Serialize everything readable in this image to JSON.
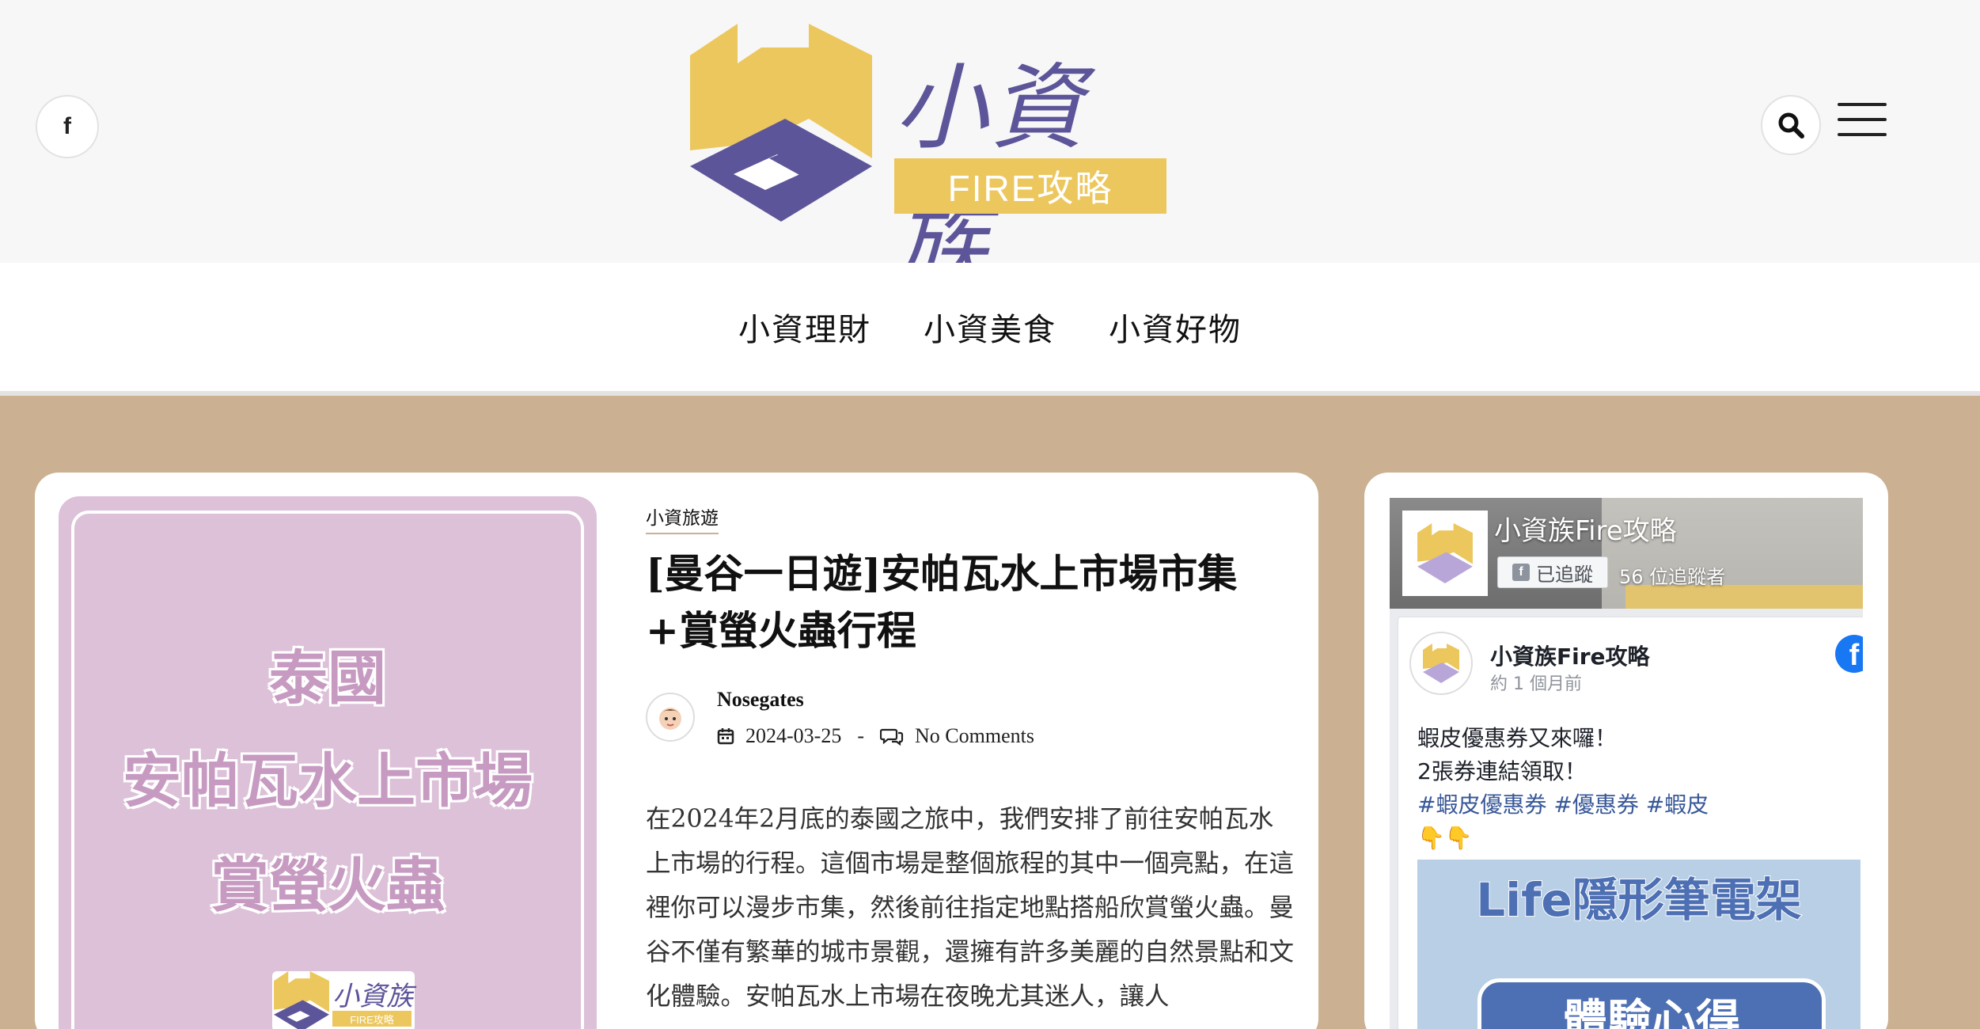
{
  "header": {
    "facebook_icon_label": "f",
    "logo": {
      "name": "小資族",
      "tagline": "FIRE攻略"
    }
  },
  "nav": {
    "items": [
      {
        "label": "小資理財"
      },
      {
        "label": "小資美食"
      },
      {
        "label": "小資好物"
      }
    ]
  },
  "post": {
    "thumbnail": {
      "line1": "泰國",
      "line2": "安帕瓦水上市場",
      "line3": "賞螢火蟲",
      "mini_logo_name": "小資族",
      "mini_logo_tagline": "FIRE攻略"
    },
    "category": "小資旅遊",
    "title": "[曼谷一日遊]安帕瓦水上市場市集+賞螢火蟲行程",
    "author": "Nosegates",
    "date": "2024-03-25",
    "separator": "-",
    "comments": "No Comments",
    "excerpt": "在2024年2月底的泰國之旅中，我們安排了前往安帕瓦水上市場的行程。這個市場是整個旅程的其中一個亮點，在這裡你可以漫步市集，然後前往指定地點搭船欣賞螢火蟲。曼谷不僅有繁華的城市景觀，還擁有許多美麗的自然景點和文化體驗。安帕瓦水上市場在夜晚尤其迷人，讓人"
  },
  "sidebar": {
    "fb_page": {
      "name": "小資族Fire攻略",
      "follow_label": "已追蹤",
      "followers": "56 位追蹤者",
      "post": {
        "author": "小資族Fire攻略",
        "time": "約 1 個月前",
        "line1": "蝦皮優惠券又來囉！",
        "line2": "2張券連結領取！",
        "hashtags": "#蝦皮優惠券 #優惠券 #蝦皮",
        "emoji": "👇👇",
        "image_title": "Life隱形筆電架",
        "image_badge": "體驗心得"
      }
    }
  },
  "colors": {
    "background": "#cbb092",
    "logo_purple": "#5d5599",
    "logo_yellow": "#ecc75e",
    "facebook_blue": "#1877f2"
  }
}
